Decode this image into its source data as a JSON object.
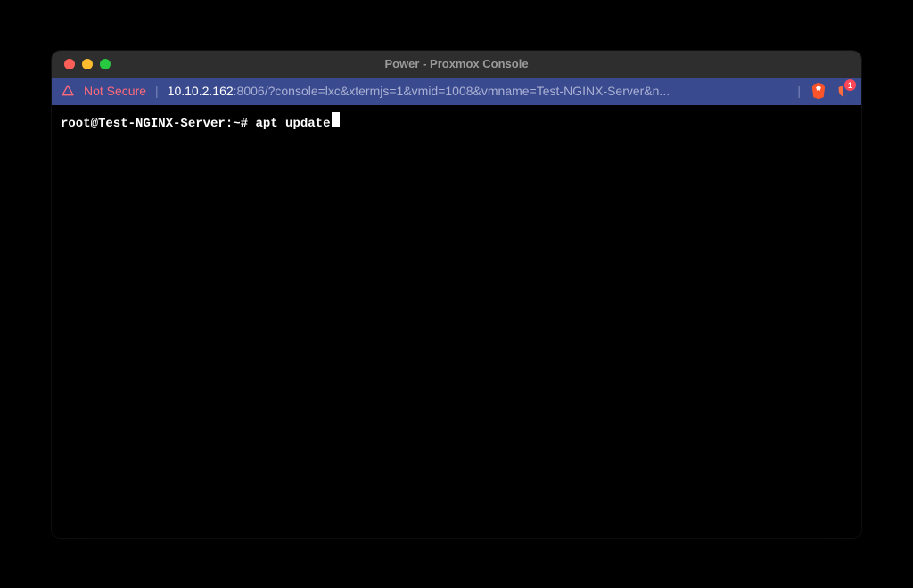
{
  "window": {
    "title": "Power - Proxmox Console"
  },
  "urlbar": {
    "not_secure": "Not Secure",
    "host": "10.10.2.162",
    "rest": ":8006/?console=lxc&xtermjs=1&vmid=1008&vmname=Test-NGINX-Server&n...",
    "shield_badge": "1"
  },
  "terminal": {
    "prompt": "root@Test-NGINX-Server:~#",
    "command": "apt update"
  }
}
